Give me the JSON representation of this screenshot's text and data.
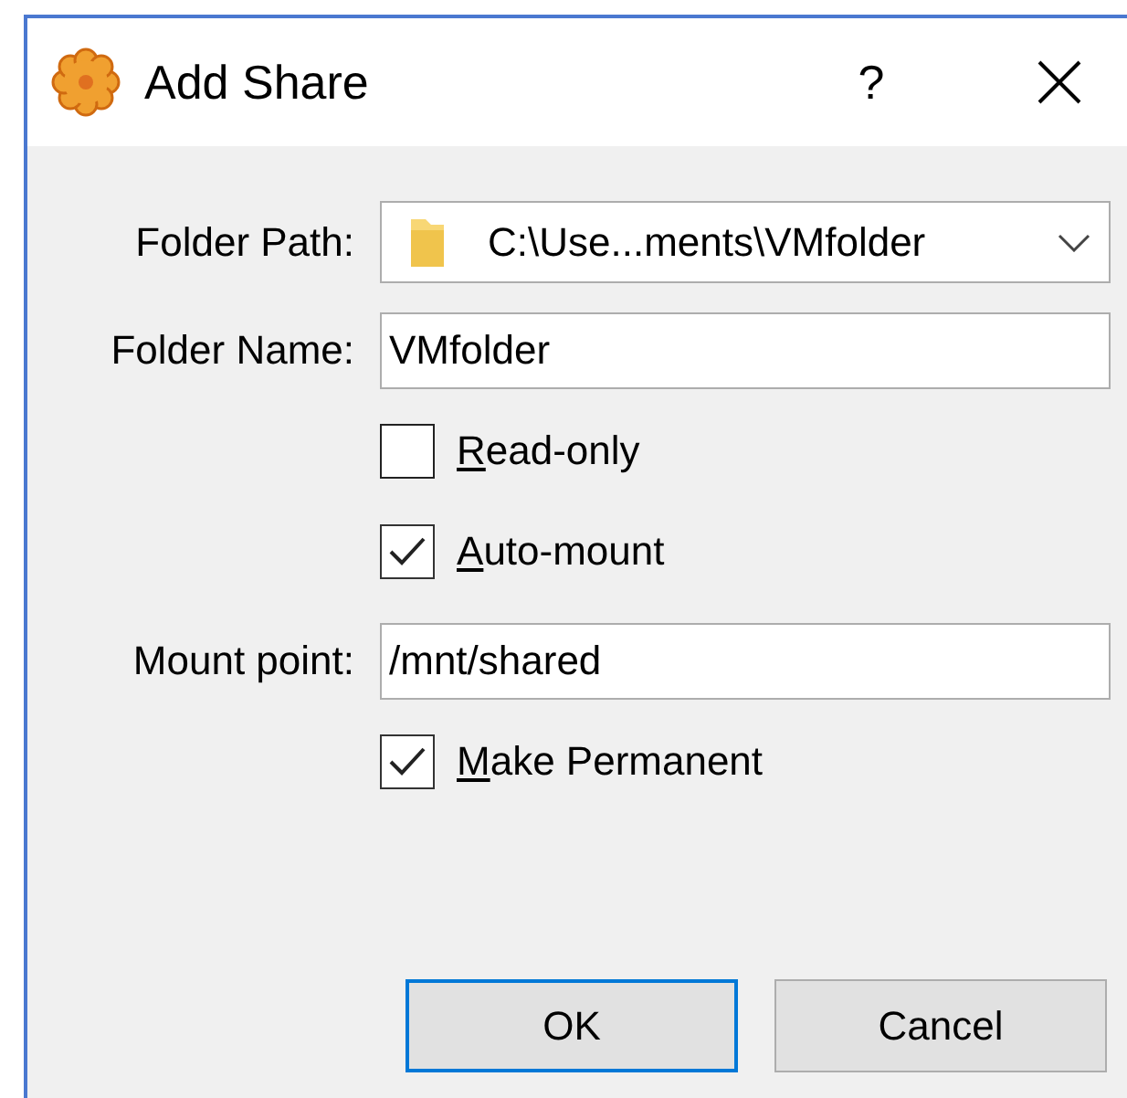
{
  "window": {
    "title": "Add Share",
    "help": "?"
  },
  "rows": [
    {
      "kind": "combo",
      "label": "Folder Path:",
      "value": "C:\\Use...ments\\VMfolder"
    },
    {
      "kind": "text",
      "label": "Folder Name:",
      "value": "VMfolder"
    },
    {
      "kind": "checkbox",
      "label": "Read-only",
      "checked": false
    },
    {
      "kind": "checkbox",
      "label": "Auto-mount",
      "checked": true
    },
    {
      "kind": "text",
      "label": "Mount point:",
      "value": "/mnt/shared"
    },
    {
      "kind": "checkbox",
      "label": "Make Permanent",
      "checked": true
    }
  ],
  "buttons": [
    {
      "label": "OK",
      "default": true
    },
    {
      "label": "Cancel",
      "default": false
    }
  ]
}
